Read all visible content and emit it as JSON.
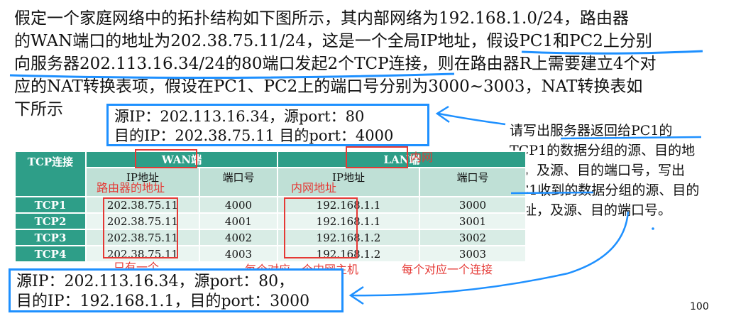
{
  "paragraph": {
    "lines": [
      "假定一个家庭网络中的拓扑结构如下图所示，其内部网络为192.168.1.0/24，路由器",
      "的WAN端口的地址为202.38.75.11/24，这是一个全局IP地址，假设PC1和PC2上分别",
      "向服务器202.113.16.34/24的80端口发起2个TCP连接，则在路由器R上需要建立4个对",
      "应的NAT转换表项，假设在PC1、PC2上的端口号分别为3000~3003，NAT转换表如",
      "下所示"
    ]
  },
  "box_top": {
    "line1": "源IP：202.113.16.34，源port：80",
    "line2": "目的IP：202.38.75.11 目的port：4000"
  },
  "box_bottom": {
    "line1": "源IP：202.113.16.34，源port：80，",
    "line2": "目的IP：192.168.1.1，目的port：3000"
  },
  "question": {
    "lines": [
      "请写出服务器返回给PC1的",
      "TCP1的数据分组的源、目的地",
      "址，及源、目的端口号，写出",
      "PC1收到的数据分组的源、目的",
      "地址，及源、目的端口号。"
    ]
  },
  "table": {
    "corner": "TCP连接",
    "wan_header": "WAN端",
    "lan_header": "LAN端",
    "sub_ip": "IP地址",
    "sub_port": "端口号",
    "rows": [
      {
        "label": "TCP1",
        "wan_ip": "202.38.75.11",
        "wan_port": "4000",
        "lan_ip": "192.168.1.1",
        "lan_port": "3000"
      },
      {
        "label": "TCP2",
        "wan_ip": "202.38.75.11",
        "wan_port": "4001",
        "lan_ip": "192.168.1.1",
        "lan_port": "3001"
      },
      {
        "label": "TCP3",
        "wan_ip": "202.38.75.11",
        "wan_port": "4002",
        "lan_ip": "192.168.1.2",
        "lan_port": "3002"
      },
      {
        "label": "TCP4",
        "wan_ip": "202.38.75.11",
        "wan_port": "4003",
        "lan_ip": "192.168.1.2",
        "lan_port": "3003"
      }
    ]
  },
  "annotations": {
    "router_addr": "路由器的地址",
    "inner_addr": "内网地址",
    "inner_net": "内网",
    "only_one": "只有一个",
    "per_host": "每个对应一个内网主机",
    "per_conn": "每个对应一个连接"
  },
  "page_number": "100",
  "colors": {
    "annotation_red": "#e53935",
    "highlight_blue": "#1e90ff",
    "table_dark": "#2e9e88"
  }
}
